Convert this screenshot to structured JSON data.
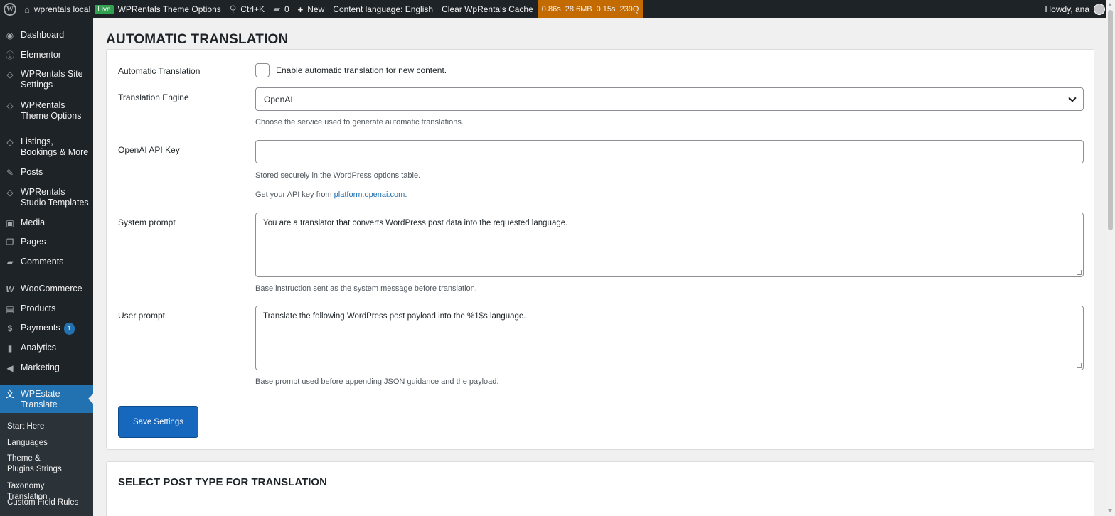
{
  "adminbar": {
    "site_name": "wprentals local",
    "live_badge": "Live",
    "theme_options": "WPRentals Theme Options",
    "search_shortcut": "Ctrl+K",
    "comments_count": "0",
    "new_label": "New",
    "content_language": "Content language: English",
    "clear_cache": "Clear WpRentals Cache",
    "qm": {
      "time": "0.86s",
      "memory": "28.6MB",
      "db_time": "0.15s",
      "queries": "239Q"
    },
    "howdy": "Howdy, ana"
  },
  "sidebar": {
    "items": [
      {
        "label": "Dashboard",
        "icon": "gauge-icon"
      },
      {
        "label": "Elementor",
        "icon": "elementor-icon"
      },
      {
        "label": "WPRentals Site Settings",
        "icon": "diamond-icon"
      },
      {
        "label": "WPRentals Theme Options",
        "icon": "diamond-icon"
      },
      {
        "label": "Listings, Bookings & More",
        "icon": "diamond-icon"
      },
      {
        "label": "Posts",
        "icon": "pin-icon"
      },
      {
        "label": "WPRentals Studio Templates",
        "icon": "diamond-icon"
      },
      {
        "label": "Media",
        "icon": "media-icon"
      },
      {
        "label": "Pages",
        "icon": "pages-icon"
      },
      {
        "label": "Comments",
        "icon": "comment-icon"
      },
      {
        "label": "WooCommerce",
        "icon": "woo-icon"
      },
      {
        "label": "Products",
        "icon": "archive-icon"
      },
      {
        "label": "Payments",
        "icon": "dollar-icon",
        "badge": "1"
      },
      {
        "label": "Analytics",
        "icon": "chart-icon"
      },
      {
        "label": "Marketing",
        "icon": "megaphone-icon"
      },
      {
        "label": "WPEstate Translate",
        "icon": "translate-icon"
      }
    ],
    "submenu": [
      "Start Here",
      "Languages",
      "Theme & Plugins Strings",
      "Taxonomy Translation",
      "Custom Field Rules"
    ]
  },
  "page": {
    "title": "AUTOMATIC TRANSLATION",
    "auto_translation_label": "Automatic Translation",
    "auto_translation_checkbox": "Enable automatic translation for new content.",
    "engine_label": "Translation Engine",
    "engine_value": "OpenAI",
    "engine_desc": "Choose the service used to generate automatic translations.",
    "api_key_label": "OpenAI API Key",
    "api_key_value": "",
    "api_key_desc": "Stored securely in the WordPress options table.",
    "api_key_link_prefix": "Get your API key from ",
    "api_key_link": "platform.openai.com",
    "api_key_link_suffix": ".",
    "system_prompt_label": "System prompt",
    "system_prompt_value": "You are a translator that converts WordPress post data into the requested language.",
    "system_prompt_desc": "Base instruction sent as the system message before translation.",
    "user_prompt_label": "User prompt",
    "user_prompt_value": "Translate the following WordPress post payload into the %1$s language.",
    "user_prompt_desc": "Base prompt used before appending JSON guidance and the payload.",
    "save_button": "Save Settings",
    "section2_title": "SELECT POST TYPE FOR TRANSLATION"
  },
  "colors": {
    "accent": "#2271b1",
    "adminbar": "#1d2327",
    "qm": "#c36b00",
    "button": "#1667be"
  }
}
